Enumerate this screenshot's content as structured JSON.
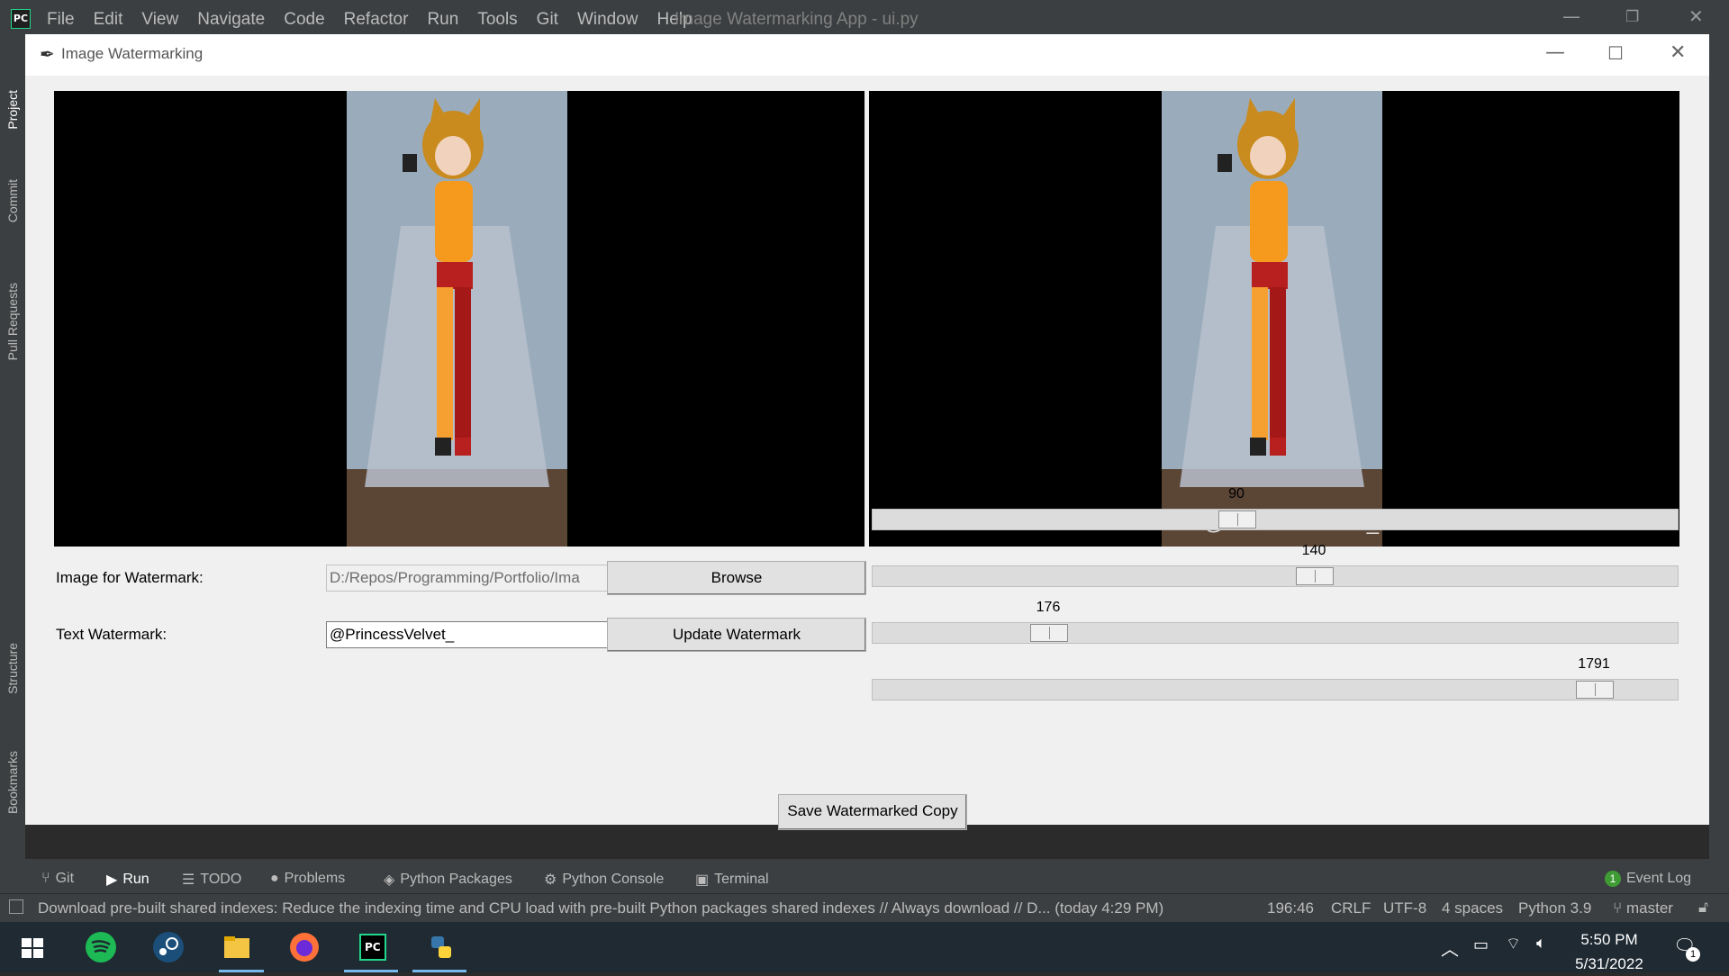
{
  "ide": {
    "title": "Image Watermarking App - ui.py",
    "logo_text": "PC",
    "menu": [
      "File",
      "Edit",
      "View",
      "Navigate",
      "Code",
      "Refactor",
      "Run",
      "Tools",
      "Git",
      "Window",
      "Help"
    ],
    "left_tabs": [
      "Project",
      "Commit",
      "Pull Requests",
      "Structure",
      "Bookmarks"
    ],
    "tool_tabs": [
      "Git",
      "Run",
      "TODO",
      "Problems",
      "Python Packages",
      "Python Console",
      "Terminal"
    ],
    "event_log": "Event Log",
    "event_count": "1",
    "status_message": "Download pre-built shared indexes: Reduce the indexing time and CPU load with pre-built Python packages shared indexes // Always download // D... (today 4:29 PM)",
    "status_items": [
      "196:46",
      "CRLF",
      "UTF-8",
      "4 spaces",
      "Python 3.9",
      "master"
    ]
  },
  "app": {
    "title": "Image Watermarking",
    "watermark_overlay": "@PrincessVelvet_",
    "image_label": "Image for Watermark:",
    "image_path": "D:/Repos/Programming/Portfolio/Ima",
    "browse_label": "Browse",
    "text_label": "Text Watermark:",
    "text_value": "@PrincessVelvet_",
    "update_label": "Update Watermark",
    "save_label": "Save Watermarked Copy",
    "sliders": [
      {
        "value": "90",
        "fraction": 0.45
      },
      {
        "value": "140",
        "fraction": 0.55
      },
      {
        "value": "176",
        "fraction": 0.205
      },
      {
        "value": "1791",
        "fraction": 0.915
      }
    ]
  },
  "taskbar": {
    "time": "5:50 PM",
    "date": "5/31/2022",
    "notification_count": "1"
  }
}
